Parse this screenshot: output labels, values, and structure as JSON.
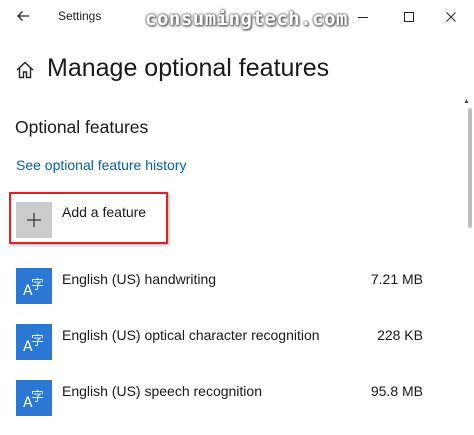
{
  "window": {
    "app_title": "Settings",
    "watermark": "consumingtech.com"
  },
  "header": {
    "title": "Manage optional features"
  },
  "section": {
    "title": "Optional features",
    "history_link": "See optional feature history"
  },
  "add_feature": {
    "label": "Add a feature"
  },
  "features": [
    {
      "name": "English (US) handwriting",
      "size": "7.21 MB"
    },
    {
      "name": "English (US) optical character recognition",
      "size": "228 KB"
    },
    {
      "name": "English (US) speech recognition",
      "size": "95.8 MB"
    }
  ],
  "colors": {
    "accent": "#0063b1",
    "feature_icon_bg": "#2b78d4",
    "highlight": "#e0202a",
    "add_button_bg": "#cccccc"
  },
  "icons": {
    "back": "back-arrow-icon",
    "home": "home-icon",
    "add": "plus-icon",
    "feature": "language-feature-icon"
  }
}
